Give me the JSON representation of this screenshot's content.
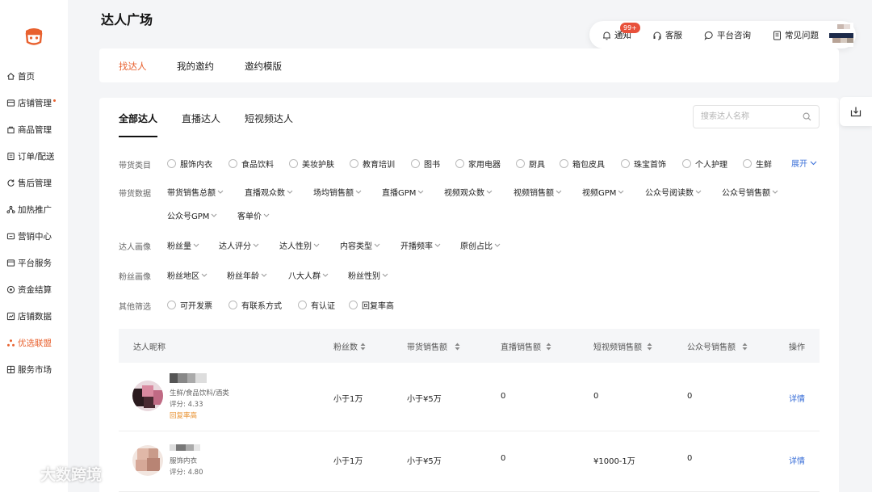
{
  "sidebar": {
    "items": [
      {
        "label": "首页",
        "icon": "home-icon"
      },
      {
        "label": "店铺管理",
        "icon": "store-icon"
      },
      {
        "label": "商品管理",
        "icon": "goods-icon"
      },
      {
        "label": "订单/配送",
        "icon": "order-icon"
      },
      {
        "label": "售后管理",
        "icon": "aftersale-icon"
      },
      {
        "label": "加热推广",
        "icon": "promotion-icon"
      },
      {
        "label": "营销中心",
        "icon": "marketing-icon"
      },
      {
        "label": "平台服务",
        "icon": "platform-icon"
      },
      {
        "label": "资金结算",
        "icon": "finance-icon"
      },
      {
        "label": "店铺数据",
        "icon": "data-icon"
      },
      {
        "label": "优选联盟",
        "icon": "alliance-icon"
      },
      {
        "label": "服务市场",
        "icon": "market-icon"
      }
    ]
  },
  "page_title": "达人广场",
  "header": {
    "notify_label": "通知",
    "notify_badge": "99+",
    "service_label": "客服",
    "consult_label": "平台咨询",
    "faq_label": "常见问题"
  },
  "top_tabs": [
    "找达人",
    "我的邀约",
    "邀约模版"
  ],
  "sub_tabs": [
    "全部达人",
    "直播达人",
    "短视频达人"
  ],
  "search": {
    "placeholder": "搜索达人名称"
  },
  "filters": {
    "category": {
      "label": "带货类目",
      "options": [
        "服饰内衣",
        "食品饮料",
        "美妆护肤",
        "教育培训",
        "图书",
        "家用电器",
        "厨具",
        "箱包皮具",
        "珠宝首饰",
        "个人护理",
        "生鲜"
      ],
      "expand_label": "展开"
    },
    "sales_data": {
      "label": "带货数据",
      "options": [
        "带货销售总额",
        "直播观众数",
        "场均销售额",
        "直播GPM",
        "视频观众数",
        "视频销售额",
        "视频GPM",
        "公众号阅读数",
        "公众号销售额",
        "公众号GPM",
        "客单价"
      ]
    },
    "profile": {
      "label": "达人画像",
      "options": [
        "粉丝量",
        "达人评分",
        "达人性别",
        "内容类型",
        "开播频率",
        "原创占比"
      ]
    },
    "fans": {
      "label": "粉丝画像",
      "options": [
        "粉丝地区",
        "粉丝年龄",
        "八大人群",
        "粉丝性别"
      ]
    },
    "other": {
      "label": "其他筛选",
      "options": [
        "可开发票",
        "有联系方式",
        "有认证",
        "回复率高"
      ]
    }
  },
  "table": {
    "headers": [
      "达人昵称",
      "粉丝数",
      "带货销售额",
      "直播销售额",
      "短视频销售额",
      "公众号销售额",
      "操作"
    ],
    "rows": [
      {
        "categories": "生鲜/食品饮料/酒类",
        "rating": "评分: 4.33",
        "tag": "回复率高",
        "fans": "小于1万",
        "sales": "小于¥5万",
        "live": "0",
        "video": "0",
        "mp": "0",
        "action": "详情"
      },
      {
        "categories": "服饰内衣",
        "rating": "评分: 4.80",
        "tag": "",
        "fans": "小于1万",
        "sales": "小于¥5万",
        "live": "0",
        "video": "¥1000-1万",
        "mp": "0",
        "action": "详情"
      }
    ]
  },
  "watermark": "大数跨境",
  "colors": {
    "accent": "#e8612f",
    "link": "#3a6fd8",
    "badge": "#e8503a"
  }
}
